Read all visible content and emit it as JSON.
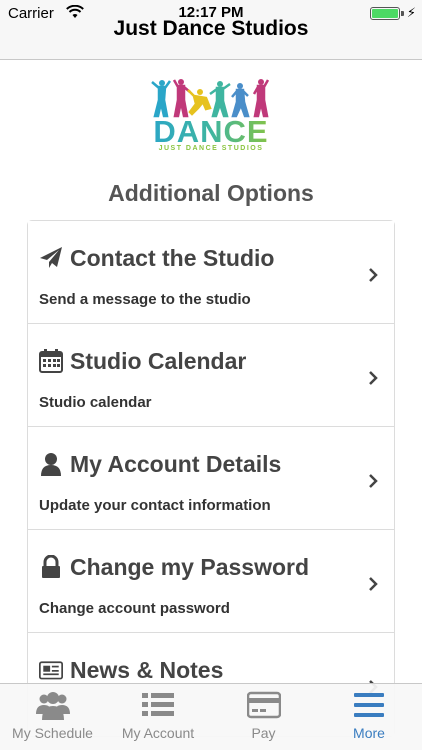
{
  "status_bar": {
    "carrier": "Carrier",
    "time": "12:17 PM"
  },
  "nav": {
    "title": "Just Dance Studios"
  },
  "logo": {
    "word": "DANCE",
    "subtitle": "JUST DANCE STUDIOS"
  },
  "section_title": "Additional Options",
  "options": [
    {
      "icon": "paper-plane-icon",
      "title": "Contact the Studio",
      "subtitle": "Send a message to the studio"
    },
    {
      "icon": "calendar-icon",
      "title": "Studio Calendar",
      "subtitle": "Studio calendar"
    },
    {
      "icon": "user-icon",
      "title": "My Account Details",
      "subtitle": "Update your contact information"
    },
    {
      "icon": "lock-icon",
      "title": "Change my Password",
      "subtitle": "Change account password"
    },
    {
      "icon": "newspaper-icon",
      "title": "News & Notes",
      "subtitle": ""
    }
  ],
  "tabs": [
    {
      "icon": "users-icon",
      "label": "My Schedule",
      "active": false
    },
    {
      "icon": "list-icon",
      "label": "My Account",
      "active": false
    },
    {
      "icon": "credit-card-icon",
      "label": "Pay",
      "active": false
    },
    {
      "icon": "menu-icon",
      "label": "More",
      "active": true
    }
  ],
  "colors": {
    "accent": "#3a7dc0",
    "battery": "#4cd964",
    "logo_teal": "#2aa6c8",
    "logo_green": "#8ac43f"
  }
}
